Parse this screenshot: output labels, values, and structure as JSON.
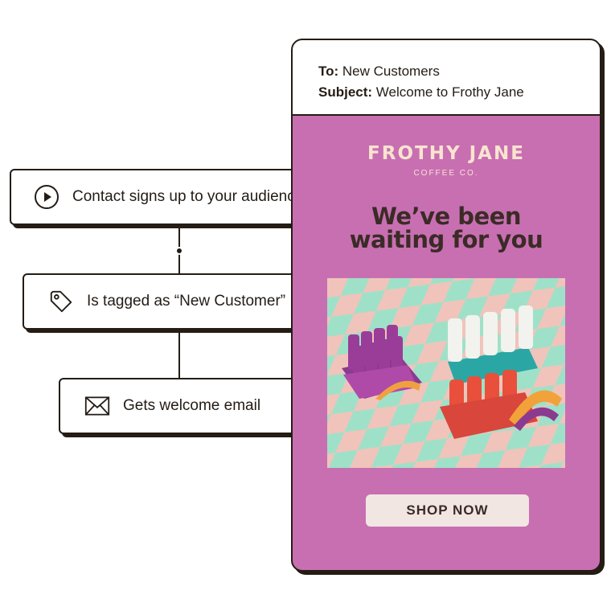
{
  "workflow": {
    "steps": [
      {
        "icon": "play-circle-icon",
        "label": "Contact signs up to your audience"
      },
      {
        "icon": "tag-icon",
        "label": "Is tagged as “New Customer”"
      },
      {
        "icon": "envelope-icon",
        "label": "Gets welcome email"
      }
    ]
  },
  "email": {
    "to_label": "To:",
    "to_value": "New Customers",
    "subject_label": "Subject:",
    "subject_value": "Welcome to Frothy Jane",
    "brand_name": "FROTHY JANE",
    "brand_sub": "COFFEE CO.",
    "headline_line1": "We’ve been",
    "headline_line2": "waiting for you",
    "cta_label": "SHOP NOW",
    "image_alt": "product-image",
    "colors": {
      "body_bg": "#c86fb2",
      "brand_text": "#f9e4d0",
      "headline": "#3b2b26",
      "button_bg": "#f2e6e2"
    }
  }
}
